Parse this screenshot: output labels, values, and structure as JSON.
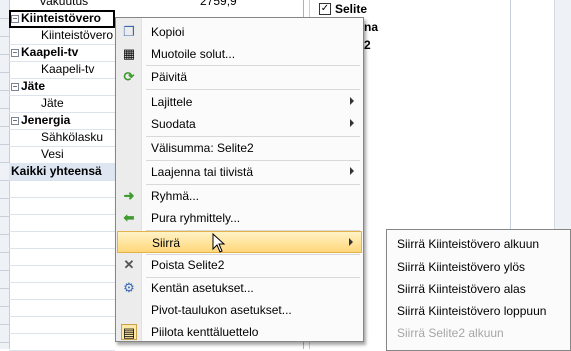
{
  "sheet": {
    "rows": [
      {
        "label": "Vakuutus",
        "value": "2759,9",
        "kind": "indent"
      },
      {
        "label": "Kiinteistövero",
        "kind": "group",
        "toggle": "−",
        "selected": true
      },
      {
        "label": "Kiinteistövero",
        "kind": "indent"
      },
      {
        "label": "Kaapeli-tv",
        "kind": "group",
        "toggle": "−"
      },
      {
        "label": "Kaapeli-tv",
        "kind": "indent"
      },
      {
        "label": "Jäte",
        "kind": "group",
        "toggle": "−"
      },
      {
        "label": "Jäte",
        "kind": "indent"
      },
      {
        "label": "Jenergia",
        "kind": "group",
        "toggle": "−"
      },
      {
        "label": "Sähkölasku",
        "kind": "indent"
      },
      {
        "label": "Vesi",
        "kind": "indent"
      },
      {
        "label": "Kaikki yhteensä",
        "kind": "total"
      }
    ]
  },
  "pane": {
    "field_selite": "Selite",
    "partial_1": "na",
    "partial_2": "2"
  },
  "menu": {
    "items": [
      {
        "label": "Kopioi",
        "icon": "copy-icon"
      },
      {
        "label": "Muotoile solut...",
        "icon": "format-cells-icon"
      },
      {
        "label": "Päivitä",
        "icon": "refresh-icon"
      },
      {
        "label": "Lajittele",
        "submenu": true
      },
      {
        "label": "Suodata",
        "submenu": true
      },
      {
        "label": "Välisumma: Selite2"
      },
      {
        "label": "Laajenna tai tiivistä",
        "submenu": true
      },
      {
        "label": "Ryhmä...",
        "icon": "group-icon"
      },
      {
        "label": "Pura ryhmittely...",
        "icon": "ungroup-icon"
      },
      {
        "label": "Siirrä",
        "submenu": true,
        "highlighted": true
      },
      {
        "label": "Poista Selite2",
        "icon": "delete-icon"
      },
      {
        "label": "Kentän asetukset...",
        "icon": "field-settings-icon"
      },
      {
        "label": "Pivot-taulukon asetukset..."
      },
      {
        "label": "Piilota kenttäluettelo",
        "icon": "field-list-icon"
      }
    ]
  },
  "submenu": {
    "items": [
      {
        "label": "Siirrä Kiinteistövero alkuun",
        "disabled": false
      },
      {
        "label": "Siirrä Kiinteistövero ylös",
        "disabled": false
      },
      {
        "label": "Siirrä Kiinteistövero alas",
        "disabled": false
      },
      {
        "label": "Siirrä Kiinteistövero loppuun",
        "disabled": false
      },
      {
        "label": "Siirrä Selite2 alkuun",
        "disabled": true
      }
    ]
  }
}
